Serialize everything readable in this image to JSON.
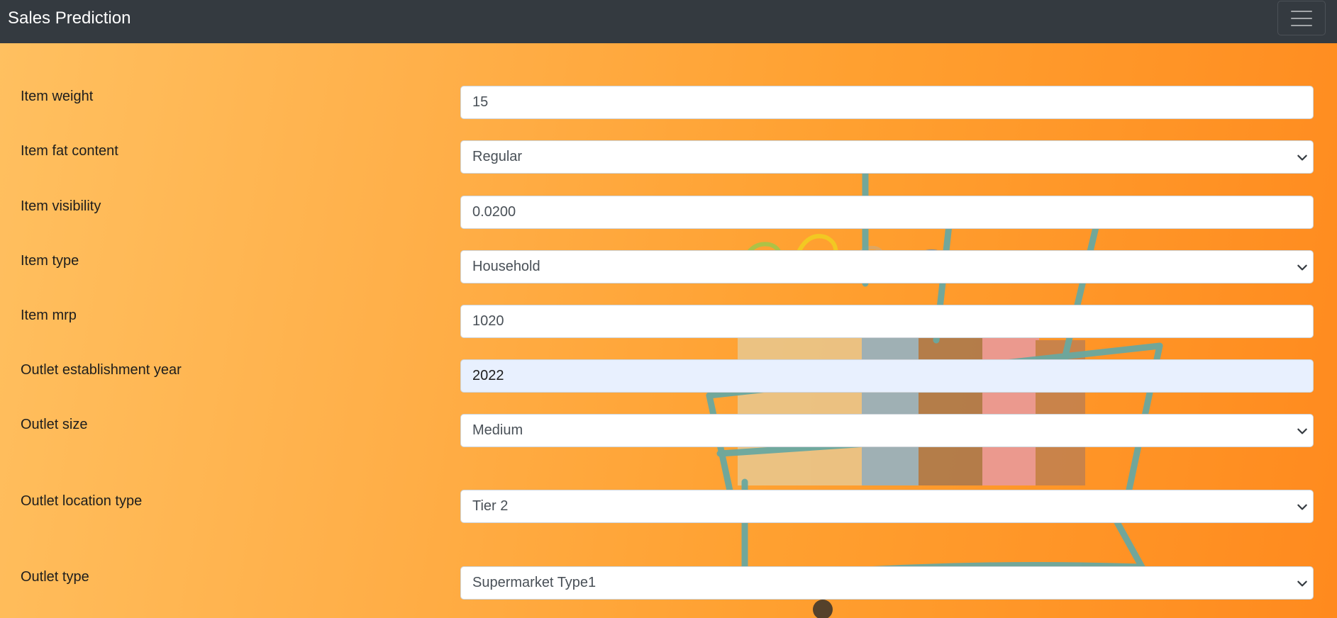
{
  "navbar": {
    "brand": "Sales Prediction",
    "toggler_icon": "hamburger-menu-icon"
  },
  "background": {
    "gradient_colors": [
      "#ffc060",
      "#ffa030",
      "#ff8a1e"
    ],
    "photo": "shopping-cart-with-bags"
  },
  "form": {
    "item_weight": {
      "label": "Item weight",
      "value": "15"
    },
    "item_fat_content": {
      "label": "Item fat content",
      "value": "Regular"
    },
    "item_visibility": {
      "label": "Item visibility",
      "value": "0.0200"
    },
    "item_type": {
      "label": "Item type",
      "value": "Household"
    },
    "item_mrp": {
      "label": "Item mrp",
      "value": "1020"
    },
    "outlet_establishment_year": {
      "label": "Outlet establishment year",
      "value": "2022"
    },
    "outlet_size": {
      "label": "Outlet size",
      "value": "Medium"
    },
    "outlet_location_type": {
      "label": "Outlet location type",
      "value": "Tier 2"
    },
    "outlet_type": {
      "label": "Outlet type",
      "value": "Supermarket Type1"
    }
  },
  "colors": {
    "navbar": "#343a40",
    "autofill_field": "#e8f0fe"
  }
}
